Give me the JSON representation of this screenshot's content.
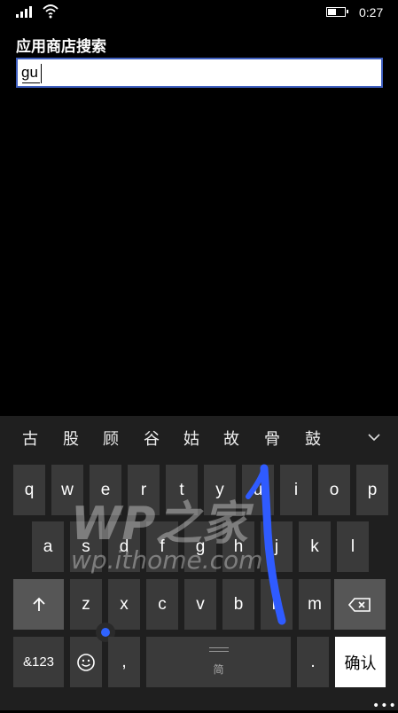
{
  "status": {
    "time": "0:27",
    "battery_level": 0.5
  },
  "search": {
    "title": "应用商店搜索",
    "query": "gu"
  },
  "keyboard": {
    "candidates": [
      "古",
      "股",
      "顾",
      "谷",
      "姑",
      "故",
      "骨",
      "鼓"
    ],
    "rows": [
      [
        "q",
        "w",
        "e",
        "r",
        "t",
        "y",
        "u",
        "i",
        "o",
        "p"
      ],
      [
        "a",
        "s",
        "d",
        "f",
        "g",
        "h",
        "j",
        "k",
        "l"
      ],
      [
        "z",
        "x",
        "c",
        "v",
        "b",
        "n",
        "m"
      ]
    ],
    "numbers_key": "&123",
    "comma_key": ",",
    "space_label": "简",
    "period_key": ".",
    "confirm_key": "确认",
    "more": "•••"
  },
  "watermark": {
    "line1": "WP之家",
    "line2": "wp.ithome.com"
  },
  "colors": {
    "accent": "#3f5fbf",
    "swipe_trail": "#2f5bff"
  }
}
